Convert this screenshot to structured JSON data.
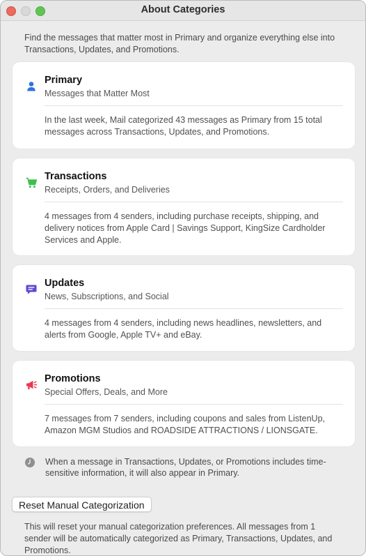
{
  "window": {
    "title": "About Categories"
  },
  "intro": "Find the messages that matter most in Primary and organize everything else into Transactions, Updates, and Promotions.",
  "categories": [
    {
      "title": "Primary",
      "subtitle": "Messages that Matter Most",
      "description": "In the last week, Mail categorized 43 messages as Primary from 15 total messages across Transactions, Updates, and Promotions.",
      "icon": "person-icon",
      "color": "#2f73e0"
    },
    {
      "title": "Transactions",
      "subtitle": "Receipts, Orders, and Deliveries",
      "description": "4 messages from 4 senders, including purchase receipts, shipping, and delivery notices from Apple Card | Savings Support, KingSize Cardholder Services and Apple.",
      "icon": "cart-icon",
      "color": "#3fbf4f"
    },
    {
      "title": "Updates",
      "subtitle": "News, Subscriptions, and Social",
      "description": "4 messages from 4 senders, including news headlines, newsletters, and alerts from Google, Apple TV+ and eBay.",
      "icon": "message-bubble-icon",
      "color": "#5b4ad4"
    },
    {
      "title": "Promotions",
      "subtitle": "Special Offers, Deals, and More",
      "description": "7 messages from 7 senders, including coupons and sales from ListenUp, Amazon MGM Studios and ROADSIDE ATTRACTIONS / LIONSGATE.",
      "icon": "megaphone-icon",
      "color": "#e8384f"
    }
  ],
  "note": {
    "text": "When a message in Transactions, Updates, or Promotions includes time-sensitive information, it will also appear in Primary.",
    "icon": "clock-icon"
  },
  "reset": {
    "button_label": "Reset Manual Categorization",
    "description": "This will reset your manual categorization preferences. All messages from 1 sender will be automatically categorized as Primary, Transactions, Updates, and Promotions."
  }
}
